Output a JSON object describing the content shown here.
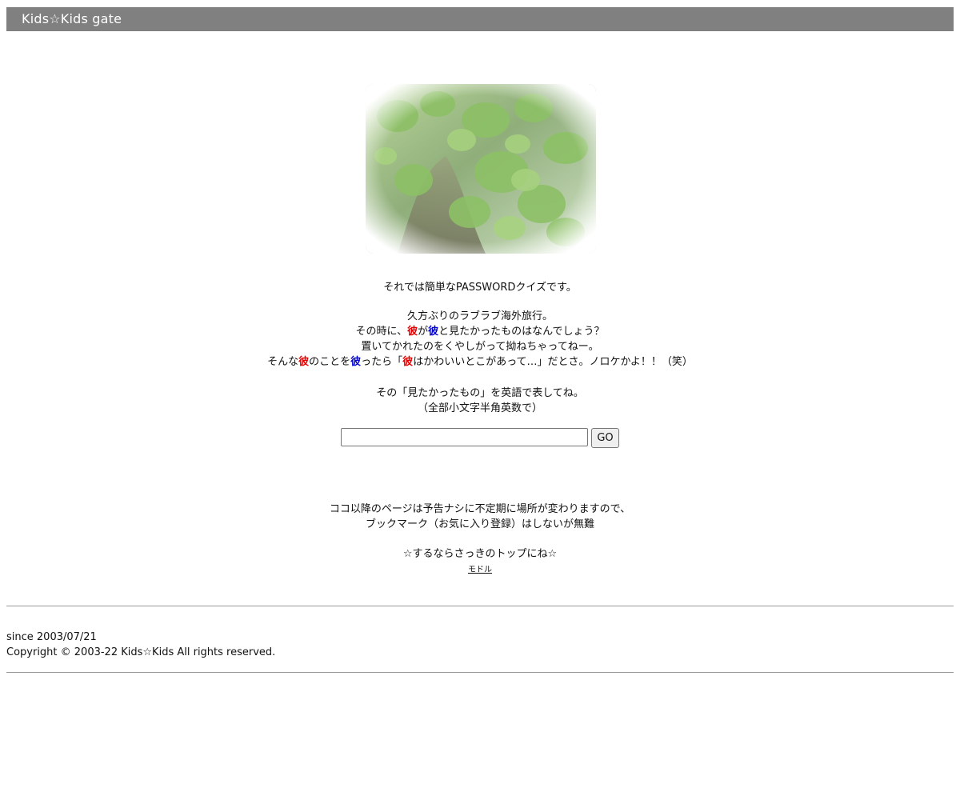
{
  "header": {
    "title": "Kids☆Kids  gate"
  },
  "quiz": {
    "intro": "それでは簡単なPASSWORDクイズです。",
    "line1": "久方ぶりのラブラブ海外旅行。",
    "line2": {
      "a": "その時に、",
      "b": "彼",
      "c": "が",
      "d": "彼",
      "e": "と見たかったものはなんでしょう？"
    },
    "line3": "置いてかれたのをくやしがって拗ねちゃってねー。",
    "line4": {
      "a": "そんな",
      "b": "彼",
      "c": "のことを",
      "d": "彼",
      "e": "ったら「",
      "f": "彼",
      "g": "はかわいいとこがあって…」だとさ。ノロケかよ！！（笑）"
    },
    "line5": "その「見たかったもの」を英語で表してね。",
    "line6": "（全部小文字半角英数で）"
  },
  "form": {
    "password_value": "",
    "go_label": "GO"
  },
  "notice": {
    "line1": "ココ以降のページは予告ナシに不定期に場所が変わりますので、",
    "line2": "ブックマーク（お気に入り登録）はしないが無難",
    "line3": "☆するならさっきのトップにね☆",
    "back_link": "モドル"
  },
  "footer": {
    "since": "since 2003/07/21",
    "copyright": "Copyright © 2003-22 Kids☆Kids All rights reserved."
  },
  "colors": {
    "titlebar": "#808080",
    "highlight_red": "#e00000",
    "highlight_blue": "#0000d0"
  }
}
